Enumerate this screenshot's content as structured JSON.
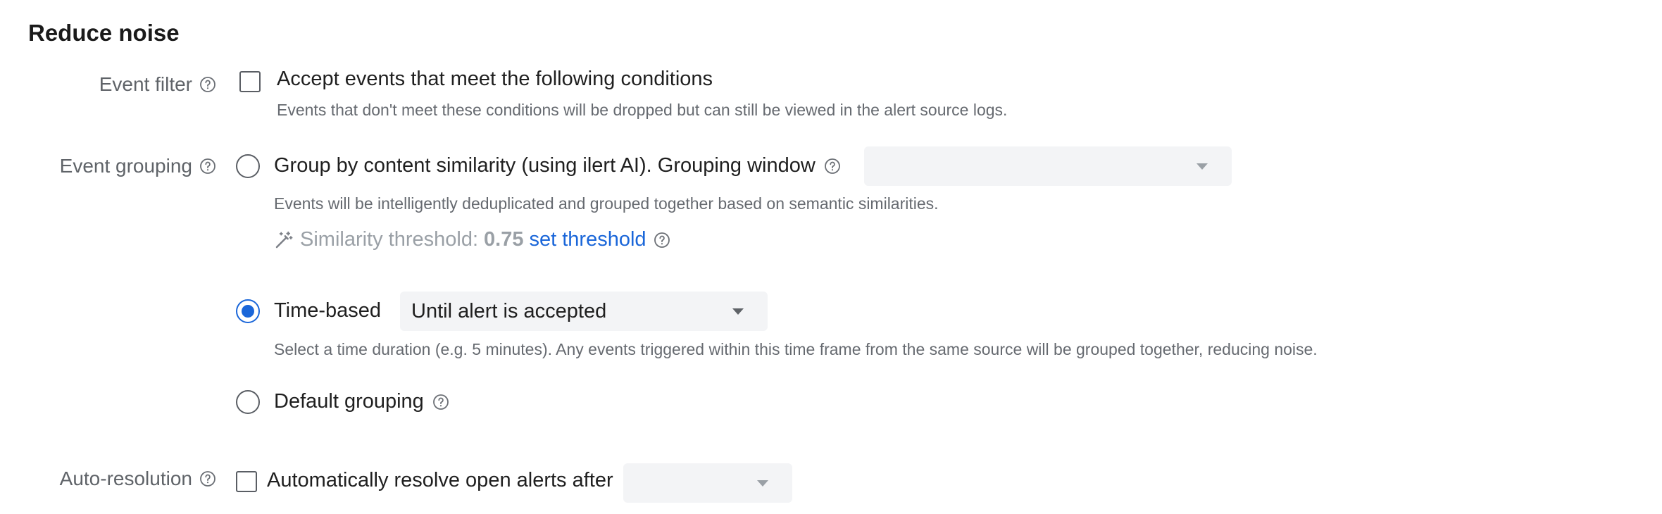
{
  "section": {
    "title": "Reduce noise"
  },
  "event_filter": {
    "label": "Event filter",
    "checkbox_label": "Accept events that meet the following conditions",
    "checked": false,
    "description": "Events that don't meet these conditions will be dropped but can still be viewed in the alert source logs."
  },
  "event_grouping": {
    "label": "Event grouping",
    "options": [
      {
        "label": "Group by content similarity (using ilert AI). Grouping window",
        "selected": false,
        "select_value": "",
        "description": "Events will be intelligently deduplicated and grouped together based on semantic similarities.",
        "threshold_label": "Similarity threshold:",
        "threshold_value": "0.75",
        "threshold_link": "set threshold"
      },
      {
        "label": "Time-based",
        "selected": true,
        "select_value": "Until alert is accepted",
        "description": "Select a time duration (e.g. 5 minutes). Any events triggered within this time frame from the same source will be grouped together, reducing noise."
      },
      {
        "label": "Default grouping",
        "selected": false
      }
    ]
  },
  "auto_resolution": {
    "label": "Auto-resolution",
    "checkbox_label": "Automatically resolve open alerts after",
    "checked": false,
    "select_value": ""
  },
  "colors": {
    "accent": "#1a66d9",
    "muted_text": "#666a70",
    "select_bg": "#f3f4f6"
  },
  "icons": {
    "help": "question-circle-icon",
    "magic": "magic-wand-icon",
    "dropdown": "caret-down-icon"
  }
}
